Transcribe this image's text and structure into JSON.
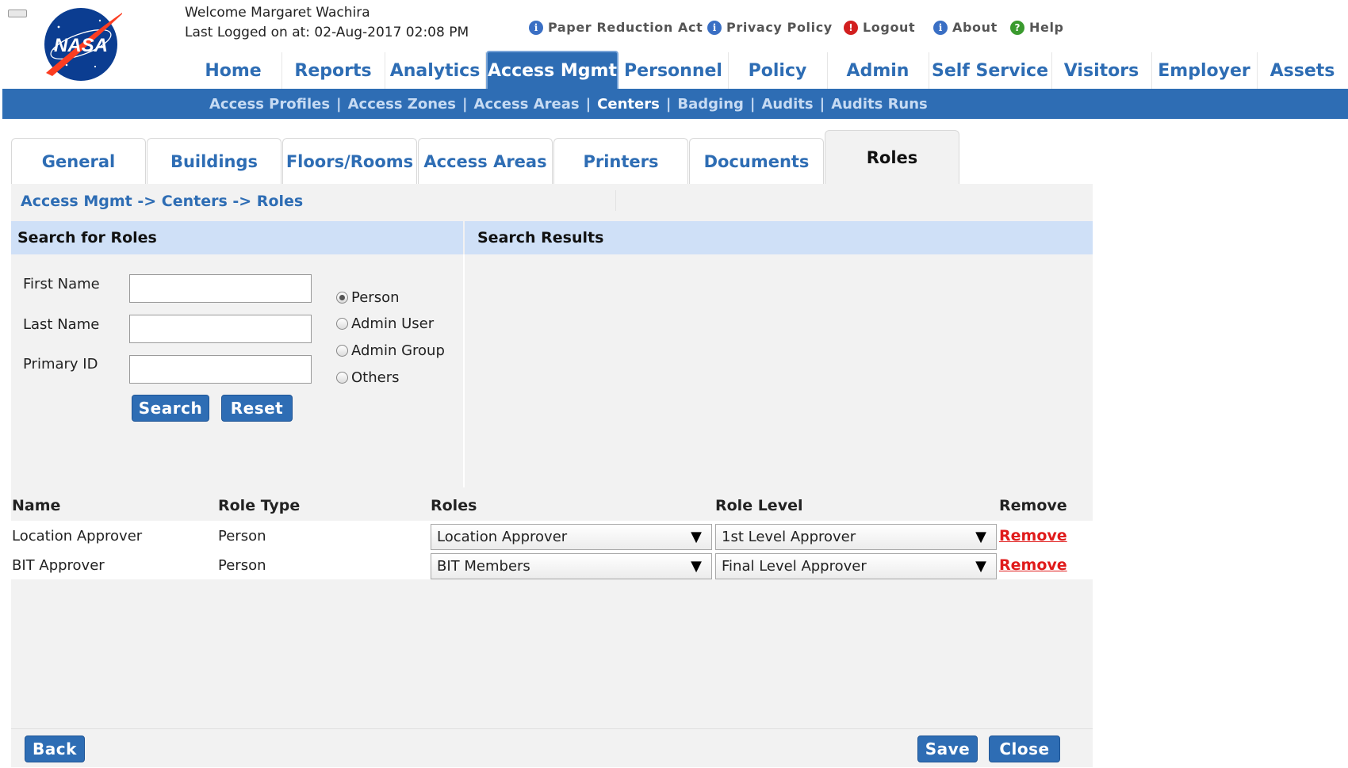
{
  "header": {
    "logo_text": "NASA",
    "welcome": "Welcome Margaret Wachira",
    "last_login": "Last Logged on at: 02-Aug-2017 02:08 PM",
    "links": [
      {
        "label": "Paper Reduction Act",
        "icon": "info-icon"
      },
      {
        "label": "Privacy Policy",
        "icon": "info-icon"
      },
      {
        "label": "Logout",
        "icon": "alert-icon"
      },
      {
        "label": "About",
        "icon": "info-icon"
      },
      {
        "label": "Help",
        "icon": "help-icon"
      }
    ]
  },
  "nav": {
    "tabs": [
      "Home",
      "Reports",
      "Analytics",
      "Access Mgmt",
      "Personnel",
      "Policy",
      "Admin",
      "Self Service",
      "Visitors",
      "Employer",
      "Assets"
    ],
    "active": "Access Mgmt",
    "sub": [
      "Access Profiles",
      "Access Zones",
      "Access Areas",
      "Centers",
      "Badging",
      "Audits",
      "Audits Runs"
    ],
    "sub_active": "Centers"
  },
  "page_tabs": {
    "items": [
      "General",
      "Buildings",
      "Floors/Rooms",
      "Access Areas",
      "Printers",
      "Documents",
      "Roles"
    ],
    "active": "Roles"
  },
  "breadcrumb": "Access Mgmt -> Centers -> Roles",
  "search": {
    "title": "Search for Roles",
    "first_name_label": "First Name",
    "first_name_value": "",
    "last_name_label": "Last Name",
    "last_name_value": "",
    "primary_id_label": "Primary ID",
    "primary_id_value": "",
    "radio_options": [
      "Person",
      "Admin User",
      "Admin Group",
      "Others"
    ],
    "radio_selected": "Person",
    "search_button": "Search",
    "reset_button": "Reset"
  },
  "results": {
    "title": "Search Results"
  },
  "roles_table": {
    "headers": [
      "Name",
      "Role Type",
      "Roles",
      "Role Level",
      "Remove"
    ],
    "rows": [
      {
        "name": "Location Approver",
        "role_type": "Person",
        "role": "Location Approver",
        "level": "1st Level Approver",
        "remove": "Remove"
      },
      {
        "name": "BIT Approver",
        "role_type": "Person",
        "role": "BIT Members",
        "level": "Final Level Approver",
        "remove": "Remove"
      }
    ]
  },
  "footer": {
    "back": "Back",
    "save": "Save",
    "close": "Close"
  },
  "colors": {
    "primary_blue": "#2e6db4",
    "section_head": "#cfe0f7",
    "remove_red": "#e01b1b"
  }
}
